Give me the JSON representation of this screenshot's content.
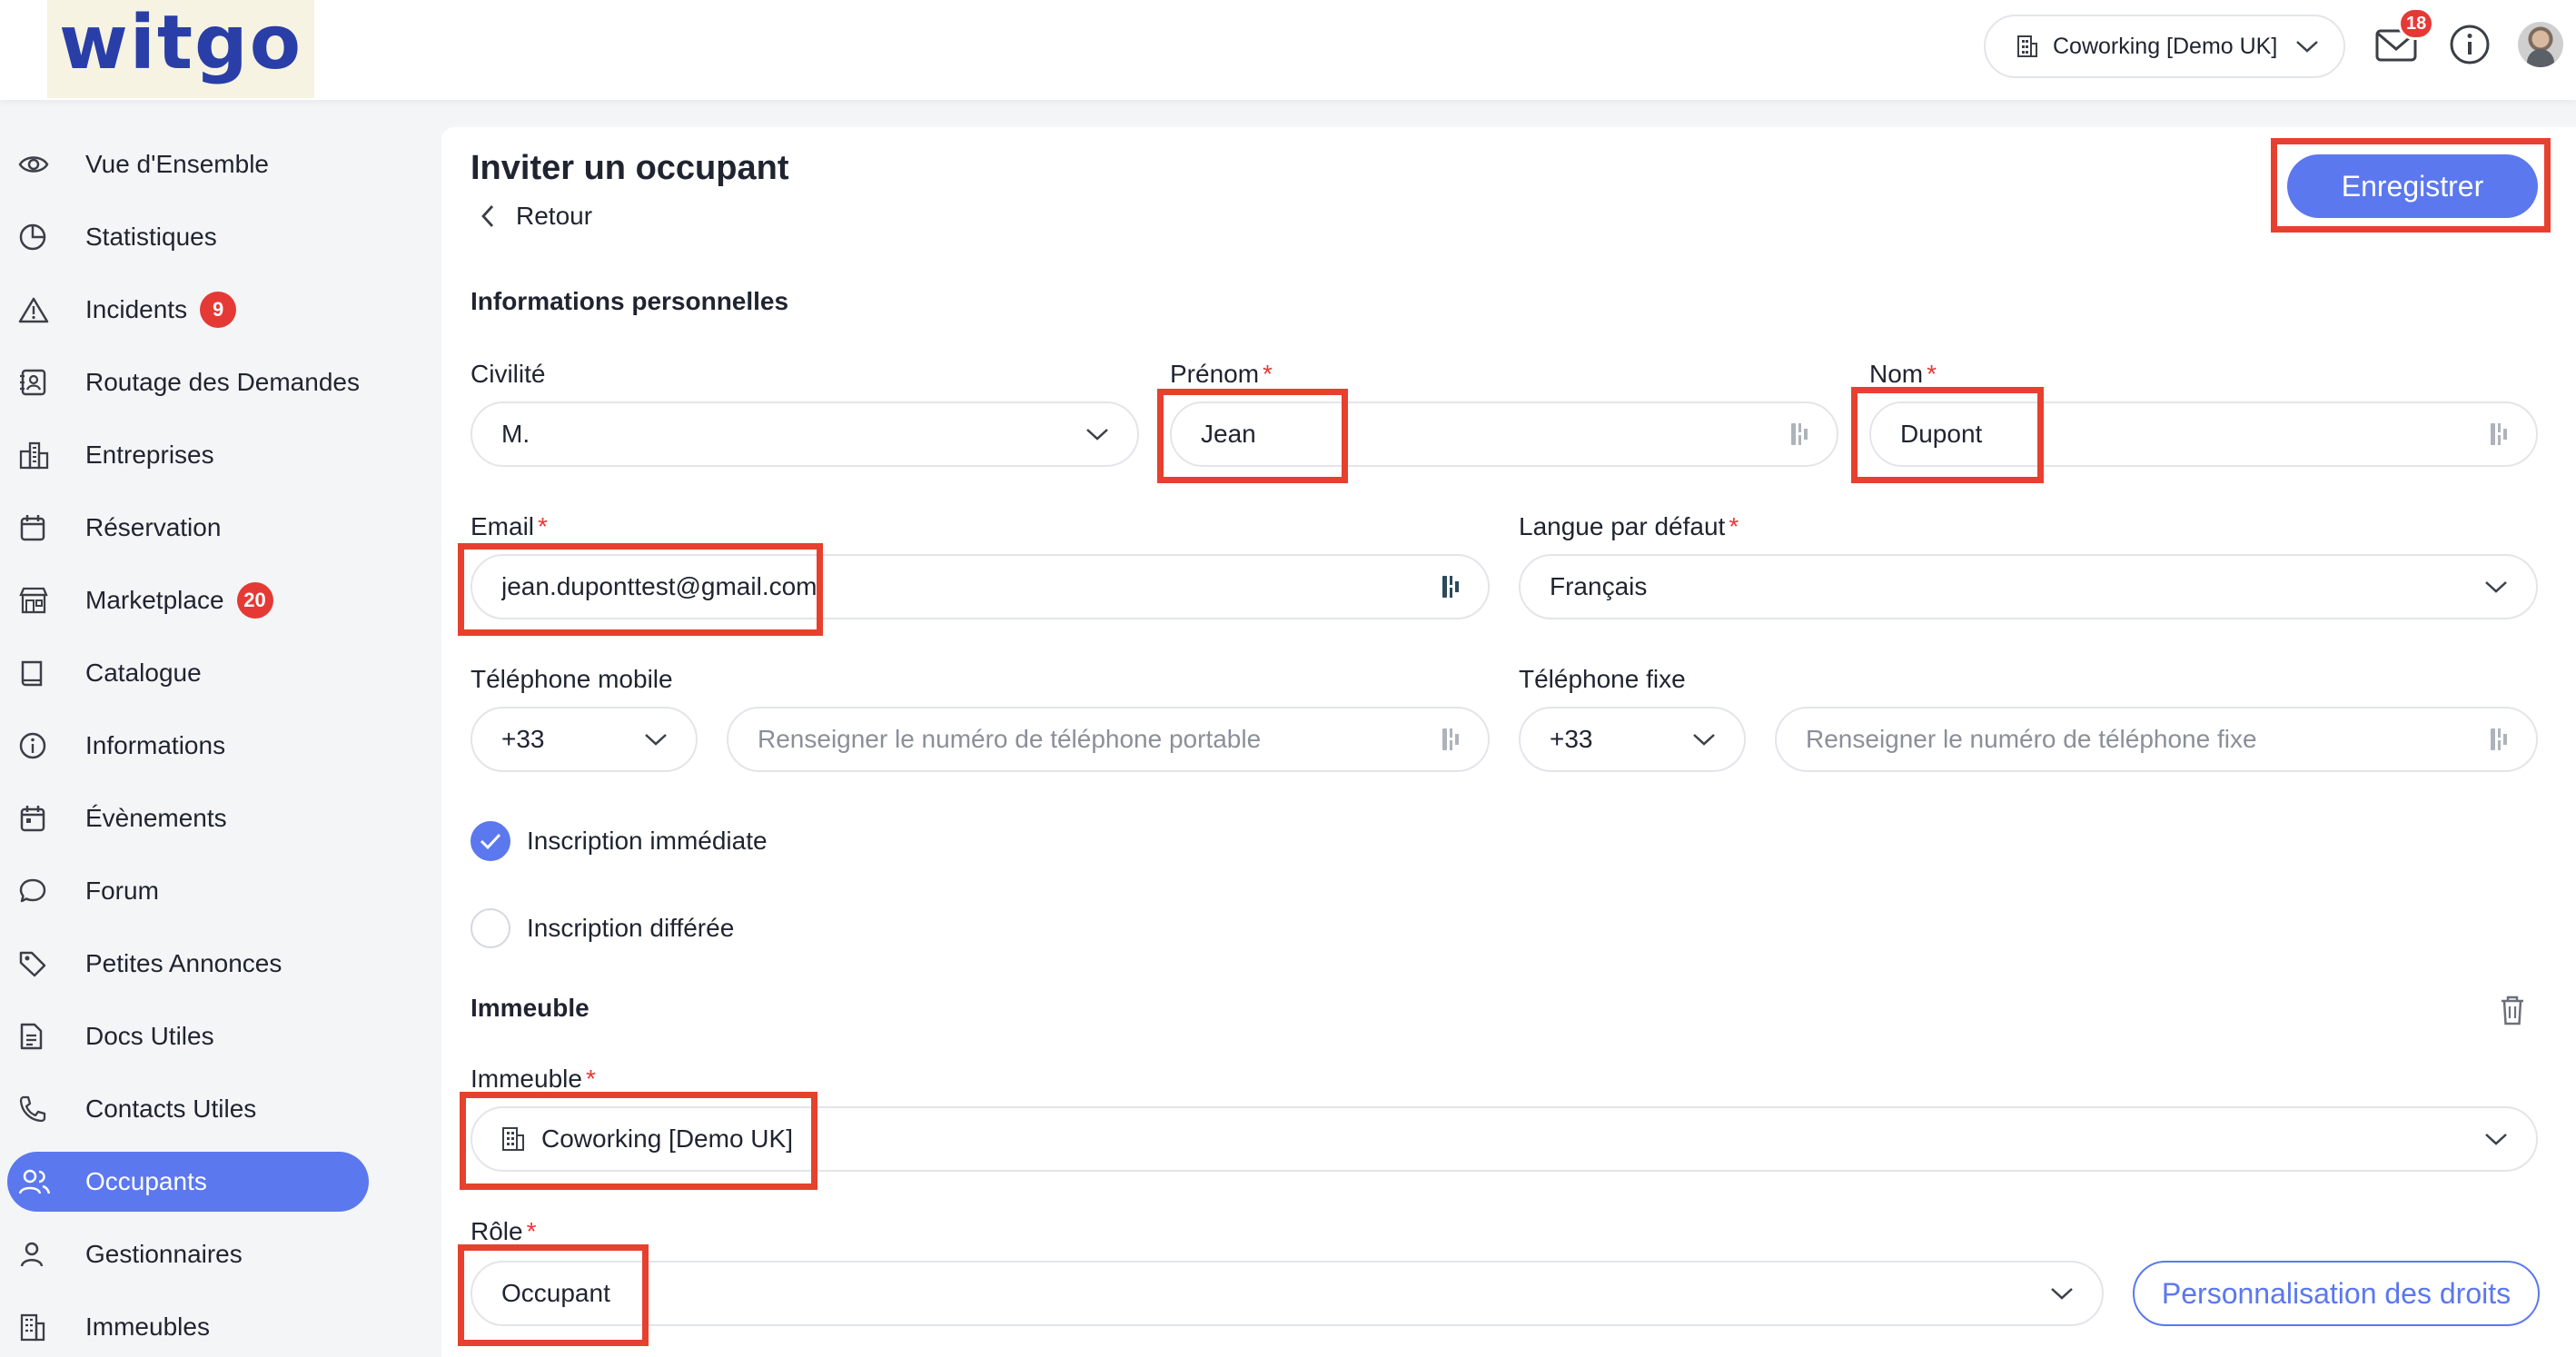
{
  "header": {
    "logo_text": "witgo",
    "building_selector": "Coworking [Demo UK]",
    "mail_count": "18"
  },
  "sidebar": {
    "items": [
      {
        "label": "Vue d'Ensemble",
        "icon": "eye-icon"
      },
      {
        "label": "Statistiques",
        "icon": "pie-chart-icon"
      },
      {
        "label": "Incidents",
        "icon": "warning-icon",
        "badge": "9"
      },
      {
        "label": "Routage des Demandes",
        "icon": "contact-book-icon"
      },
      {
        "label": "Entreprises",
        "icon": "buildings-icon"
      },
      {
        "label": "Réservation",
        "icon": "calendar-icon"
      },
      {
        "label": "Marketplace",
        "icon": "store-icon",
        "badge": "20"
      },
      {
        "label": "Catalogue",
        "icon": "book-icon"
      },
      {
        "label": "Informations",
        "icon": "info-icon"
      },
      {
        "label": "Évènements",
        "icon": "calendar-event-icon"
      },
      {
        "label": "Forum",
        "icon": "chat-bubble-icon"
      },
      {
        "label": "Petites Annonces",
        "icon": "tag-icon"
      },
      {
        "label": "Docs Utiles",
        "icon": "document-icon"
      },
      {
        "label": "Contacts Utiles",
        "icon": "phone-sos-icon"
      },
      {
        "label": "Occupants",
        "icon": "users-icon",
        "active": true
      },
      {
        "label": "Gestionnaires",
        "icon": "user-icon"
      },
      {
        "label": "Immeubles",
        "icon": "building-icon"
      }
    ]
  },
  "page": {
    "title": "Inviter un occupant",
    "back_label": "Retour",
    "save_label": "Enregistrer"
  },
  "personal": {
    "section_title": "Informations personnelles",
    "civility_label": "Civilité",
    "civility_value": "M.",
    "firstname_label": "Prénom",
    "firstname_value": "Jean",
    "lastname_label": "Nom",
    "lastname_value": "Dupont",
    "email_label": "Email",
    "email_value": "jean.duponttest@gmail.com",
    "language_label": "Langue par défaut",
    "language_value": "Français",
    "mobile_label": "Téléphone mobile",
    "mobile_code": "+33",
    "mobile_placeholder": "Renseigner le numéro de téléphone portable",
    "landline_label": "Téléphone fixe",
    "landline_code": "+33",
    "landline_placeholder": "Renseigner le numéro de téléphone fixe",
    "required_mark": "*"
  },
  "registration": {
    "immediate_label": "Inscription immédiate",
    "deferred_label": "Inscription différée",
    "selected": "immediate"
  },
  "building": {
    "section_title": "Immeuble",
    "building_label": "Immeuble",
    "building_value": "Coworking [Demo UK]",
    "role_label": "Rôle",
    "role_value": "Occupant",
    "permissions_button": "Personnalisation des droits"
  },
  "colors": {
    "accent": "#5b78ee",
    "badge": "#e53935",
    "highlight": "#e8402f"
  }
}
